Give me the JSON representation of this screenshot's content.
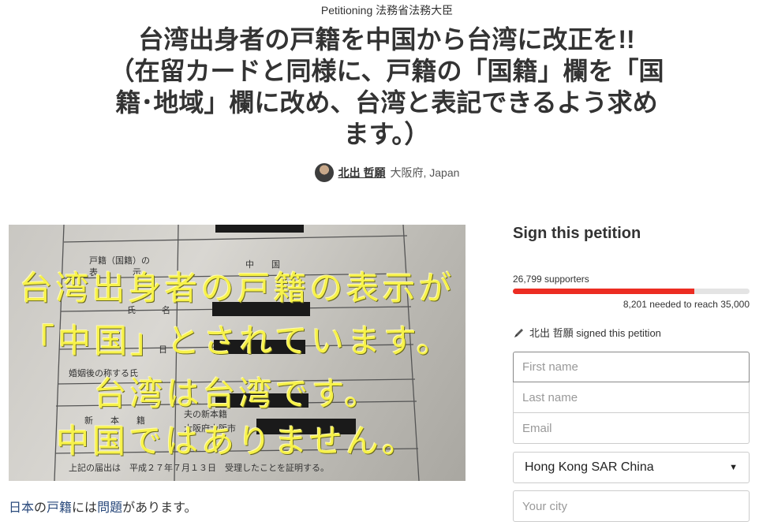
{
  "header": {
    "target": "Petitioning 法務省法務大臣",
    "title_lines": [
      "台湾出身者の戸籍を中国から台湾に改正を!!",
      "（在留カードと同様に、戸籍の「国籍」欄を「国",
      "籍･地域」欄に改め、台湾と表記できるよう求め",
      "ます。）"
    ],
    "author_name": "北出 哲願",
    "author_location": "大阪府, Japan"
  },
  "media": {
    "overlay_lines": [
      "台湾出身者の戸籍の表示が",
      "「中国」とされています。",
      "台湾は台湾です。",
      "中国ではありません。"
    ],
    "doc_labels": {
      "nationality_label": "戸籍（国籍）の",
      "display_label": "表　　　　示",
      "nationality_value": "中　　国",
      "name_label": "氏　　　名",
      "date_label": "日",
      "marriage_label": "婚姻後の称する氏",
      "domicile_label": "新　　本　　籍",
      "husband_domicile": "夫の新本籍",
      "osaka": "大阪府大阪市",
      "certificate": "上記の届出は　平成２７年７月１３日　受理したことを証明する。"
    }
  },
  "description": {
    "segments": [
      "日本",
      "の",
      "戸籍",
      "には",
      "問題",
      "があります。"
    ]
  },
  "sidebar": {
    "heading": "Sign this petition",
    "supporters": "26,799 supporters",
    "progress": 0.7657,
    "needed": "8,201 needed to reach 35,000",
    "signed_by": "北出 哲願 signed this petition"
  },
  "form": {
    "first_name_placeholder": "First name",
    "last_name_placeholder": "Last name",
    "email_placeholder": "Email",
    "country_selected": "Hong Kong SAR China",
    "city_placeholder": "Your city"
  },
  "colors": {
    "progress_fill": "#ec2c22",
    "overlay_text": "#f7f24a"
  }
}
